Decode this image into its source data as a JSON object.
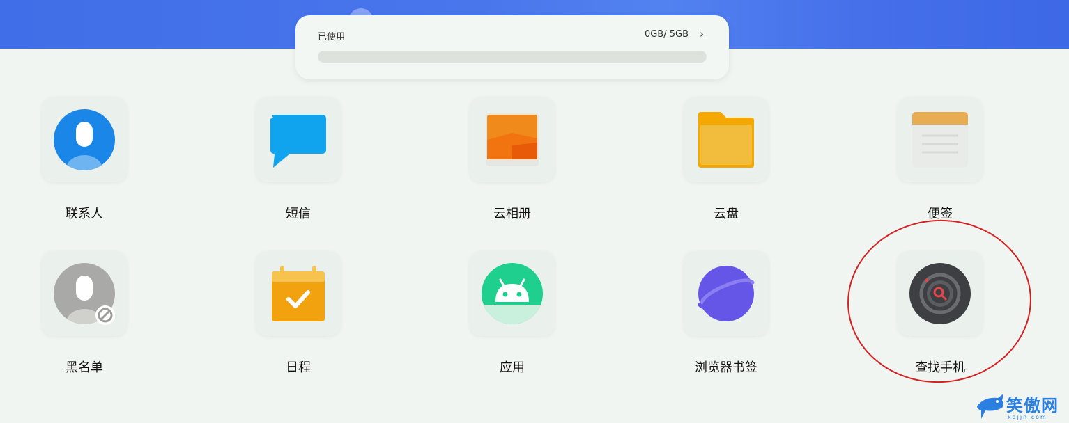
{
  "storage": {
    "label": "已使用",
    "value": "0GB/ 5GB",
    "used_fraction": 0
  },
  "apps": [
    {
      "label": "联系人",
      "icon": "contacts-icon"
    },
    {
      "label": "短信",
      "icon": "message-icon"
    },
    {
      "label": "云相册",
      "icon": "cloud-album-icon"
    },
    {
      "label": "云盘",
      "icon": "folder-icon"
    },
    {
      "label": "便签",
      "icon": "notes-icon"
    },
    {
      "label": "黑名单",
      "icon": "blocked-contact-icon"
    },
    {
      "label": "日程",
      "icon": "calendar-icon"
    },
    {
      "label": "应用",
      "icon": "android-icon"
    },
    {
      "label": "浏览器书签",
      "icon": "planet-icon"
    },
    {
      "label": "查找手机",
      "icon": "find-phone-icon"
    }
  ],
  "watermark": {
    "text": "笑傲网",
    "url": "xajjn.com"
  },
  "colors": {
    "banner": "#3f6ee8",
    "annotation_circle": "#d42020",
    "page_background": "#f0f5f1"
  }
}
